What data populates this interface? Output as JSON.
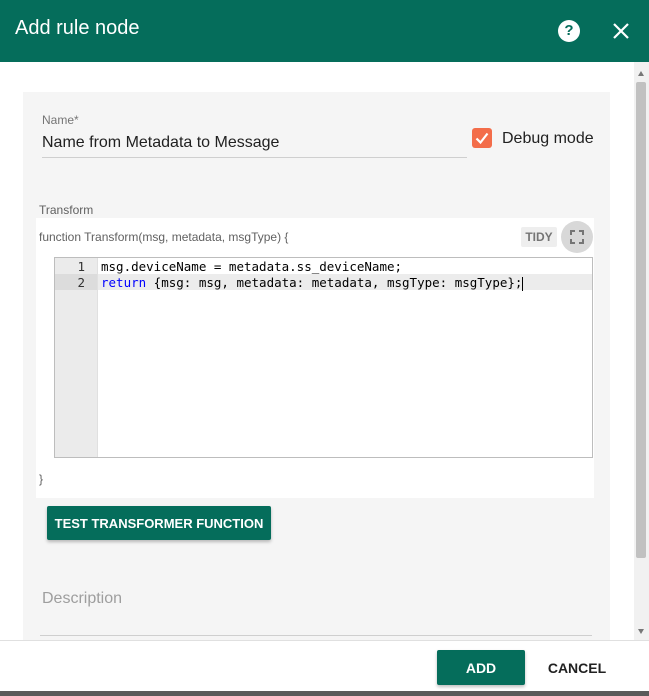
{
  "dialog": {
    "title": "Add rule node",
    "help_icon": "help-circle-icon",
    "close_icon": "close-icon"
  },
  "form": {
    "name_label": "Name",
    "name_required_marker": "*",
    "name_value": "Name from Metadata to Message",
    "debug_label": "Debug mode",
    "debug_checked": true,
    "transform_label": "Transform",
    "function_header": "function Transform(msg, metadata, msgType) {",
    "function_footer": "}",
    "tidy_label": "TIDY",
    "fullscreen_icon": "fullscreen-icon",
    "code_lines": [
      {
        "num": "1",
        "text": "msg.deviceName = metadata.ss_deviceName;"
      },
      {
        "num": "2",
        "keyword": "return",
        "text": " {msg: msg, metadata: metadata, msgType: msgType};"
      }
    ],
    "test_button_label": "TEST TRANSFORMER FUNCTION",
    "description_placeholder": "Description"
  },
  "footer": {
    "add_label": "ADD",
    "cancel_label": "CANCEL"
  },
  "colors": {
    "primary": "#056d5b",
    "checkbox": "#f36d4a"
  }
}
